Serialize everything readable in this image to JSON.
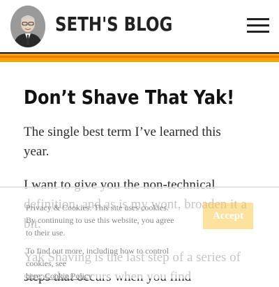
{
  "header": {
    "site_title": "SETH'S BLOG",
    "avatar_icon": "person-photo",
    "menu_icon": "hamburger-menu-icon"
  },
  "colors": {
    "stripe_orange": "#f7a400",
    "stripe_dark": "#e97d00",
    "rule": "#111111",
    "accept_button": "#fac850"
  },
  "post": {
    "title": "Don’t Shave That Yak!",
    "paragraphs": [
      "The single best term I’ve learned this year.",
      "I want to give you the non-technical definition, and as is my wont, broaden it a bit.",
      "Yak Shaving is the last step of a series of steps that occurs when you find"
    ]
  },
  "cookie_notice": {
    "line1": "Privacy & Cookies: This site uses cookies.",
    "line2": "By continuing to use this website, you agree",
    "line3": "to their use.",
    "line4": "To find out more, including how to control cookies, see",
    "link": "here: Cookie Policy",
    "accept_label": "Accept"
  }
}
